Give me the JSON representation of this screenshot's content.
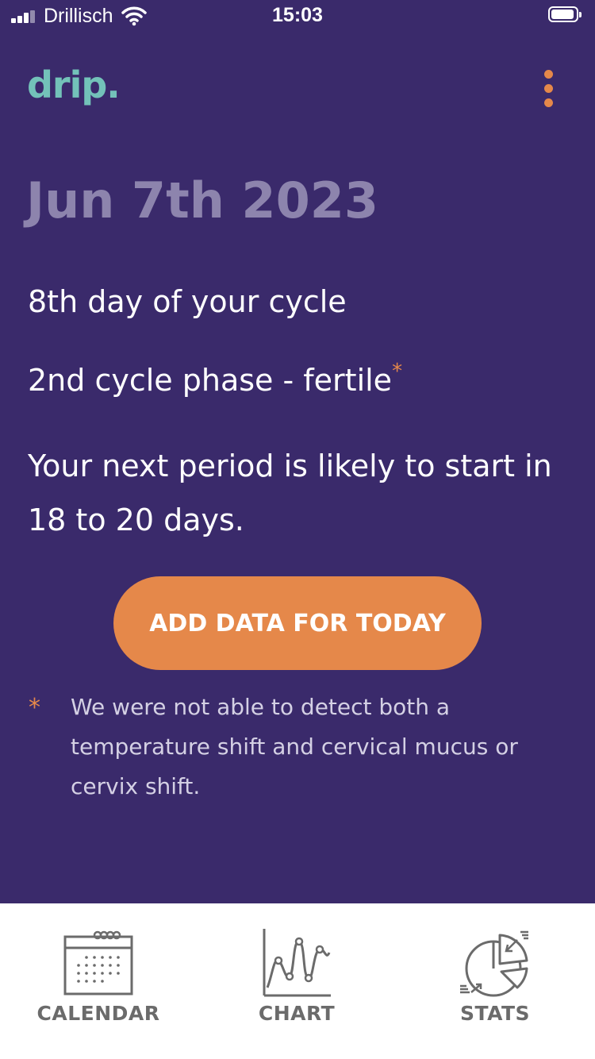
{
  "status_bar": {
    "carrier": "Drillisch",
    "time": "15:03"
  },
  "header": {
    "logo": "drip.",
    "menu_icon": "more-vertical-icon"
  },
  "main": {
    "date": "Jun 7th 2023",
    "cycle_day": "8th day of your cycle",
    "cycle_phase": "2nd cycle phase - fertile",
    "cycle_phase_marker": "*",
    "prediction": "Your next period is likely to start in 18 to 20 days.",
    "add_button_label": "ADD DATA FOR TODAY",
    "footnote_marker": "*",
    "footnote": "We were not able to detect both a temperature shift and cervical mucus or cervix shift."
  },
  "tabs": [
    {
      "label": "CALENDAR",
      "icon": "calendar-icon"
    },
    {
      "label": "CHART",
      "icon": "line-chart-icon"
    },
    {
      "label": "STATS",
      "icon": "pie-chart-icon"
    }
  ],
  "colors": {
    "background": "#3a2a6b",
    "accent": "#e5884a",
    "logo": "#73c2b9",
    "date": "#8d84ad",
    "tab_bar": "#ffffff",
    "tab_text": "#6b6b6b"
  }
}
